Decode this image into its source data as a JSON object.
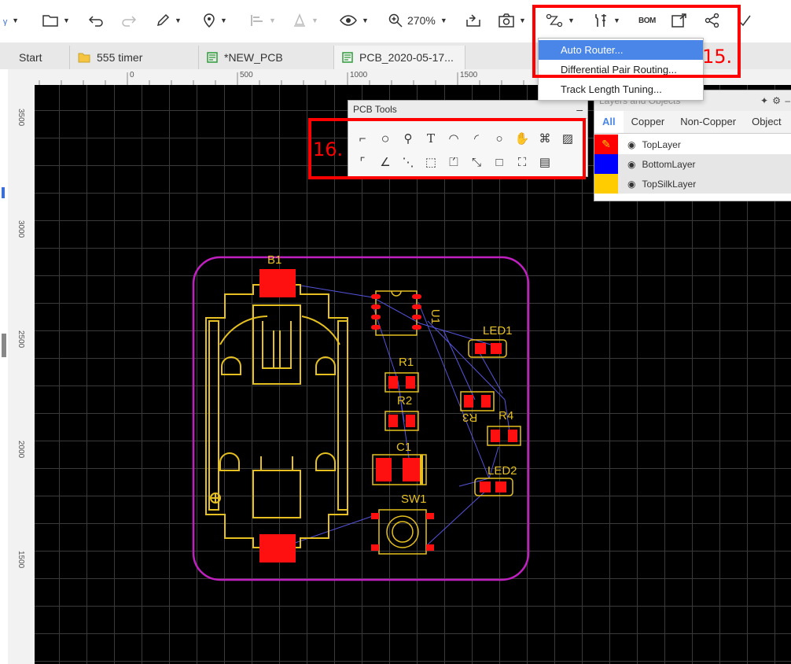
{
  "toolbar": {
    "zoom": "270%",
    "bom_label": "BOM"
  },
  "tabs": [
    {
      "label": "Start"
    },
    {
      "label": "555 timer"
    },
    {
      "label": "*NEW_PCB"
    },
    {
      "label": "PCB_2020-05-17..."
    }
  ],
  "ruler": {
    "top": [
      "0",
      "500",
      "1000",
      "1500"
    ],
    "left": [
      "3500",
      "3000",
      "2500",
      "2000",
      "1500"
    ]
  },
  "route_menu": {
    "items": [
      {
        "label": "Auto Router..."
      },
      {
        "label": "Differential Pair Routing..."
      },
      {
        "label": "Track Length Tuning..."
      }
    ]
  },
  "pcb_tools": {
    "title": "PCB Tools"
  },
  "layers_panel": {
    "title": "Layers and Objects",
    "tabs": [
      "All",
      "Copper",
      "Non-Copper",
      "Object"
    ],
    "layers": [
      {
        "name": "TopLayer",
        "color": "#ff0000"
      },
      {
        "name": "BottomLayer",
        "color": "#0000ff"
      },
      {
        "name": "TopSilkLayer",
        "color": "#ffcc00"
      }
    ]
  },
  "board": {
    "designators": {
      "b1": "B1",
      "u1": "U1",
      "led1": "LED1",
      "r1": "R1",
      "r2": "R2",
      "r3": "R3",
      "r4": "R4",
      "c1": "C1",
      "led2": "LED2",
      "sw1": "SW1"
    },
    "outline_color": "#c020c0",
    "silk_color": "#e6c020",
    "pad_color": "#ff1010"
  },
  "callouts": {
    "c15": "15.",
    "c16": "16."
  }
}
